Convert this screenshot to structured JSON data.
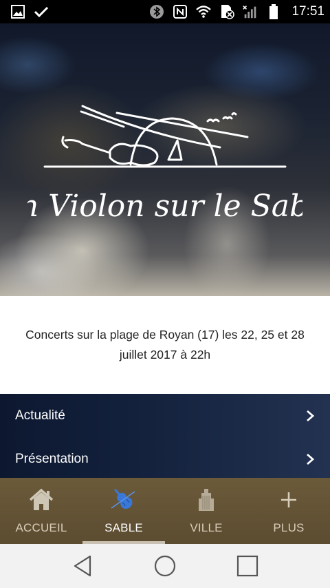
{
  "status_bar": {
    "time": "17:51",
    "icons": [
      "image-icon",
      "check-icon",
      "bluetooth-icon",
      "nfc-icon",
      "wifi-icon",
      "no-sim-icon",
      "signal-icon",
      "battery-icon"
    ]
  },
  "hero": {
    "logo_text": "Un Violon sur le Sable"
  },
  "intro": {
    "text": "Concerts sur la plage de Royan (17) les 22, 25 et 28\njuillet 2017 à 22h"
  },
  "menu": {
    "items": [
      {
        "label": "Actualité",
        "icon": "chevron-right-icon"
      },
      {
        "label": "Présentation",
        "icon": "chevron-right-icon"
      }
    ]
  },
  "tabbar": {
    "tabs": [
      {
        "label": "ACCUEIL",
        "icon": "home-icon",
        "active": false
      },
      {
        "label": "SABLE",
        "icon": "violin-icon",
        "active": true
      },
      {
        "label": "VILLE",
        "icon": "building-icon",
        "active": false
      },
      {
        "label": "PLUS",
        "icon": "plus-icon",
        "active": false
      }
    ]
  },
  "navbar": {
    "buttons": [
      "back-icon",
      "home-circle-icon",
      "recents-icon"
    ]
  },
  "colors": {
    "menu_bg": "#14223e",
    "tabbar_bg": "#5c4c30",
    "active_tab_icon": "#3a78d8"
  }
}
